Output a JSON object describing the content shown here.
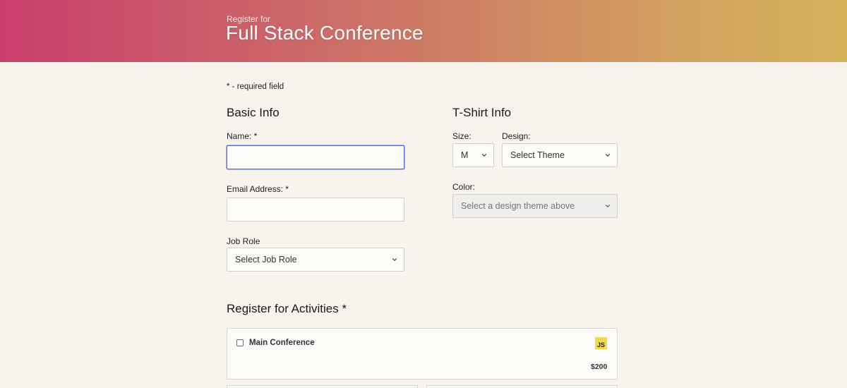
{
  "header": {
    "pre_title": "Register for",
    "title": "Full Stack Conference"
  },
  "required_note": "* - required field",
  "basic_info": {
    "heading": "Basic Info",
    "name_label": "Name: *",
    "name_value": "",
    "email_label": "Email Address: *",
    "email_value": "",
    "job_role_label": "Job Role",
    "job_role_selected": "Select Job Role"
  },
  "tshirt_info": {
    "heading": "T-Shirt Info",
    "size_label": "Size:",
    "size_selected": "M",
    "design_label": "Design:",
    "design_selected": "Select Theme",
    "color_label": "Color:",
    "color_selected": "Select a design theme above",
    "color_disabled": true
  },
  "activities": {
    "heading": "Register for Activities *",
    "items": [
      {
        "name": "Main Conference",
        "badge": "JS",
        "price": "$200",
        "checked": false
      }
    ]
  },
  "colors": {
    "accent_focus": "#5b6ee1",
    "header_gradient_start": "#c93e6d",
    "header_gradient_end": "#d6b25c",
    "background": "#f8f4ed",
    "js_badge": "#f0db4f"
  },
  "icons": {
    "select_arrow": "chevron-down-icon",
    "activity_badge": "javascript-icon"
  }
}
